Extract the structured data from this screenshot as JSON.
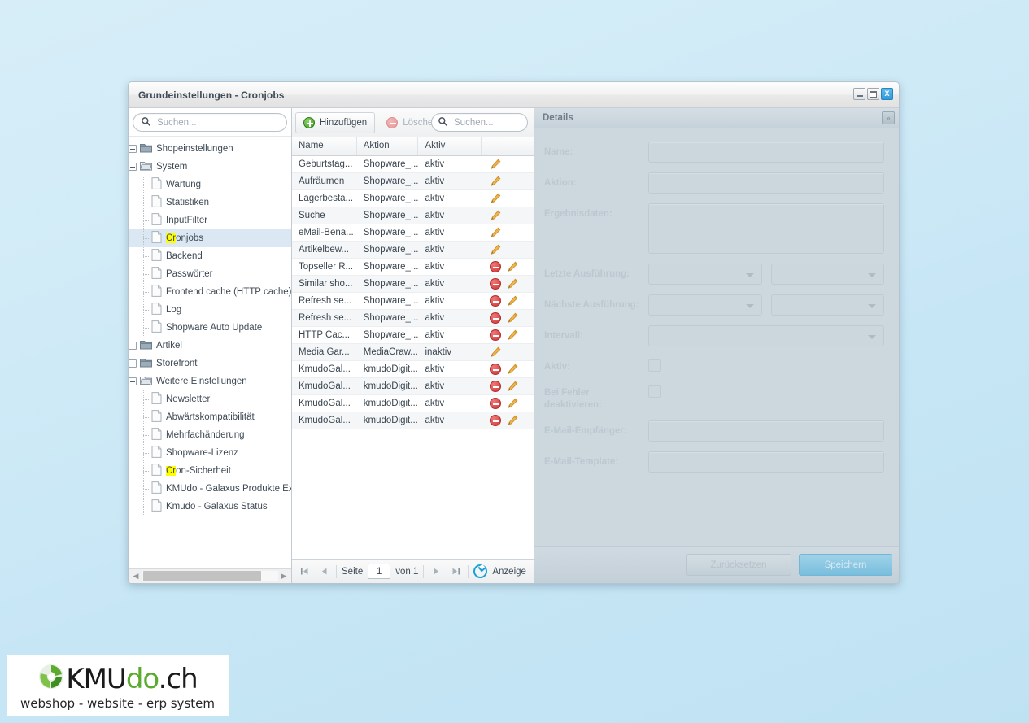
{
  "window": {
    "title": "Grundeinstellungen - Cronjobs",
    "buttons": {
      "minimize": "minimize-button",
      "maximize": "maximize-button",
      "close": "X"
    }
  },
  "tree": {
    "search_placeholder": "Suchen...",
    "search_value": "",
    "nodes": [
      {
        "label": "Shopeinstellungen",
        "type": "folder",
        "state": "collapsed",
        "depth": 0
      },
      {
        "label": "System",
        "type": "folder",
        "state": "expanded",
        "depth": 0
      },
      {
        "label": "Wartung",
        "type": "leaf",
        "depth": 1
      },
      {
        "label": "Statistiken",
        "type": "leaf",
        "depth": 1
      },
      {
        "label": "InputFilter",
        "type": "leaf",
        "depth": 1
      },
      {
        "label": "Cronjobs",
        "type": "leaf",
        "depth": 1,
        "selected": true,
        "highlight": "Cr"
      },
      {
        "label": "Backend",
        "type": "leaf",
        "depth": 1
      },
      {
        "label": "Passwörter",
        "type": "leaf",
        "depth": 1
      },
      {
        "label": "Frontend cache (HTTP cache)",
        "type": "leaf",
        "depth": 1
      },
      {
        "label": "Log",
        "type": "leaf",
        "depth": 1
      },
      {
        "label": "Shopware Auto Update",
        "type": "leaf",
        "depth": 1
      },
      {
        "label": "Artikel",
        "type": "folder",
        "state": "collapsed",
        "depth": 0
      },
      {
        "label": "Storefront",
        "type": "folder",
        "state": "collapsed",
        "depth": 0
      },
      {
        "label": "Weitere Einstellungen",
        "type": "folder",
        "state": "expanded",
        "depth": 0
      },
      {
        "label": "Newsletter",
        "type": "leaf",
        "depth": 1
      },
      {
        "label": "Abwärtskompatibilität",
        "type": "leaf",
        "depth": 1
      },
      {
        "label": "Mehrfachänderung",
        "type": "leaf",
        "depth": 1
      },
      {
        "label": "Shopware-Lizenz",
        "type": "leaf",
        "depth": 1
      },
      {
        "label": "Cron-Sicherheit",
        "type": "leaf",
        "depth": 1,
        "highlight": "Cr"
      },
      {
        "label": "KMUdo - Galaxus Produkte Export",
        "type": "leaf",
        "depth": 1
      },
      {
        "label": "Kmudo - Galaxus Status",
        "type": "leaf",
        "depth": 1
      }
    ]
  },
  "grid": {
    "toolbar": {
      "add_label": "Hinzufügen",
      "delete_label": "Löschen",
      "search_placeholder": "Suchen...",
      "search_value": ""
    },
    "columns": [
      "Name",
      "Aktion",
      "Aktiv",
      ""
    ],
    "rows": [
      {
        "name": "Geburtstag...",
        "aktion": "Shopware_...",
        "aktiv": "aktiv",
        "can_delete": false
      },
      {
        "name": "Aufräumen",
        "aktion": "Shopware_...",
        "aktiv": "aktiv",
        "can_delete": false
      },
      {
        "name": "Lagerbesta...",
        "aktion": "Shopware_...",
        "aktiv": "aktiv",
        "can_delete": false
      },
      {
        "name": "Suche",
        "aktion": "Shopware_...",
        "aktiv": "aktiv",
        "can_delete": false
      },
      {
        "name": "eMail-Bena...",
        "aktion": "Shopware_...",
        "aktiv": "aktiv",
        "can_delete": false
      },
      {
        "name": "Artikelbew...",
        "aktion": "Shopware_...",
        "aktiv": "aktiv",
        "can_delete": false
      },
      {
        "name": "Topseller R...",
        "aktion": "Shopware_...",
        "aktiv": "aktiv",
        "can_delete": true
      },
      {
        "name": "Similar sho...",
        "aktion": "Shopware_...",
        "aktiv": "aktiv",
        "can_delete": true
      },
      {
        "name": "Refresh se...",
        "aktion": "Shopware_...",
        "aktiv": "aktiv",
        "can_delete": true
      },
      {
        "name": "Refresh se...",
        "aktion": "Shopware_...",
        "aktiv": "aktiv",
        "can_delete": true
      },
      {
        "name": "HTTP Cac...",
        "aktion": "Shopware_...",
        "aktiv": "aktiv",
        "can_delete": true
      },
      {
        "name": "Media Gar...",
        "aktion": "MediaCraw...",
        "aktiv": "inaktiv",
        "can_delete": false
      },
      {
        "name": "KmudoGal...",
        "aktion": "kmudoDigit...",
        "aktiv": "aktiv",
        "can_delete": true
      },
      {
        "name": "KmudoGal...",
        "aktion": "kmudoDigit...",
        "aktiv": "aktiv",
        "can_delete": true
      },
      {
        "name": "KmudoGal...",
        "aktion": "kmudoDigit...",
        "aktiv": "aktiv",
        "can_delete": true
      },
      {
        "name": "KmudoGal...",
        "aktion": "kmudoDigit...",
        "aktiv": "aktiv",
        "can_delete": true
      }
    ],
    "pager": {
      "page_label": "Seite",
      "page_value": "1",
      "of_label": "von 1",
      "display_label": "Anzeige"
    }
  },
  "details": {
    "title": "Details",
    "collapse_glyph": "»",
    "fields": {
      "name_label": "Name:",
      "name_value": "",
      "aktion_label": "Aktion:",
      "aktion_value": "",
      "ergebnisdaten_label": "Ergebnisdaten:",
      "ergebnisdaten_value": "",
      "letzte_label": "Letzte Ausführung:",
      "naechste_label": "Nächste Ausführung:",
      "intervall_label": "Intervall:",
      "aktiv_label": "Aktiv:",
      "bei_fehler_label": "Bei Fehler deaktivieren:",
      "email_empfaenger_label": "E-Mail-Empfänger:",
      "email_empfaenger_value": "",
      "email_template_label": "E-Mail-Template:",
      "email_template_value": ""
    },
    "footer": {
      "reset_label": "Zurücksetzen",
      "save_label": "Speichern"
    }
  },
  "logo": {
    "word_1": "KMU",
    "word_2": "do",
    "word_3": ".ch",
    "tagline": "webshop - website - erp system"
  },
  "colors": {
    "accent_blue": "#2f9adc",
    "highlight_yellow": "#ffff00",
    "delete_red": "#cf3636",
    "add_green": "#3f9b23",
    "edit_orange": "#e8a33d",
    "selection_blue": "#dbe8f3"
  }
}
